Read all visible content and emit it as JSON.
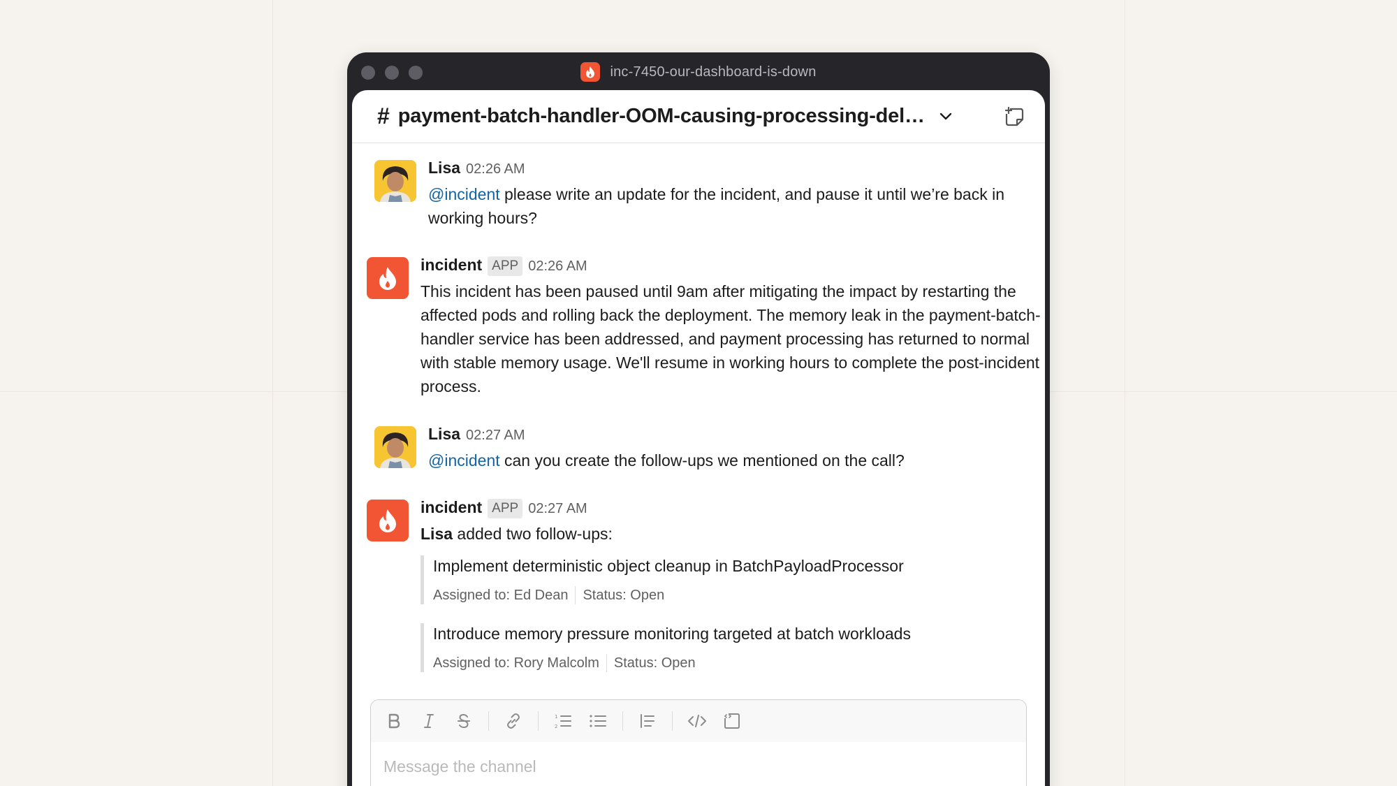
{
  "window": {
    "title": "inc-7450-our-dashboard-is-down"
  },
  "channel": {
    "hash": "#",
    "name": "payment-batch-handler-OOM-causing-processing-del…"
  },
  "messages": [
    {
      "sender": "Lisa",
      "time": "02:26 AM",
      "mention": "@incident",
      "text": " please write an update for the incident, and pause it until we’re back in working hours?"
    },
    {
      "sender": "incident",
      "badge": "APP",
      "time": "02:26 AM",
      "text": "This incident has been paused until 9am after mitigating the impact by restarting the affected pods and rolling back the deployment. The memory leak in the payment-batch-handler service has been addressed, and payment processing has returned to normal with stable memory usage. We'll resume in working hours to complete the post-incident process."
    },
    {
      "sender": "Lisa",
      "time": "02:27 AM",
      "mention": "@incident",
      "text": " can you create the follow-ups we mentioned on the call?"
    },
    {
      "sender": "incident",
      "badge": "APP",
      "time": "02:27 AM",
      "actor": "Lisa",
      "text": " added two follow-ups:",
      "followups": [
        {
          "title": "Implement deterministic object cleanup in BatchPayloadProcessor",
          "assigned": "Assigned to: Ed Dean",
          "status": "Status: Open"
        },
        {
          "title": "Introduce memory pressure monitoring targeted at batch workloads",
          "assigned": "Assigned to: Rory Malcolm",
          "status": "Status: Open"
        }
      ]
    }
  ],
  "composer": {
    "placeholder": "Message the channel",
    "tools": [
      "bold-icon",
      "italic-icon",
      "strikethrough-icon",
      "link-icon",
      "ordered-list-icon",
      "bulleted-list-icon",
      "blockquote-icon",
      "code-icon",
      "code-block-icon"
    ]
  },
  "colors": {
    "brand": "#f25533",
    "mention": "#1264a3",
    "window_frame": "#25252a",
    "background": "#f6f3ee"
  }
}
